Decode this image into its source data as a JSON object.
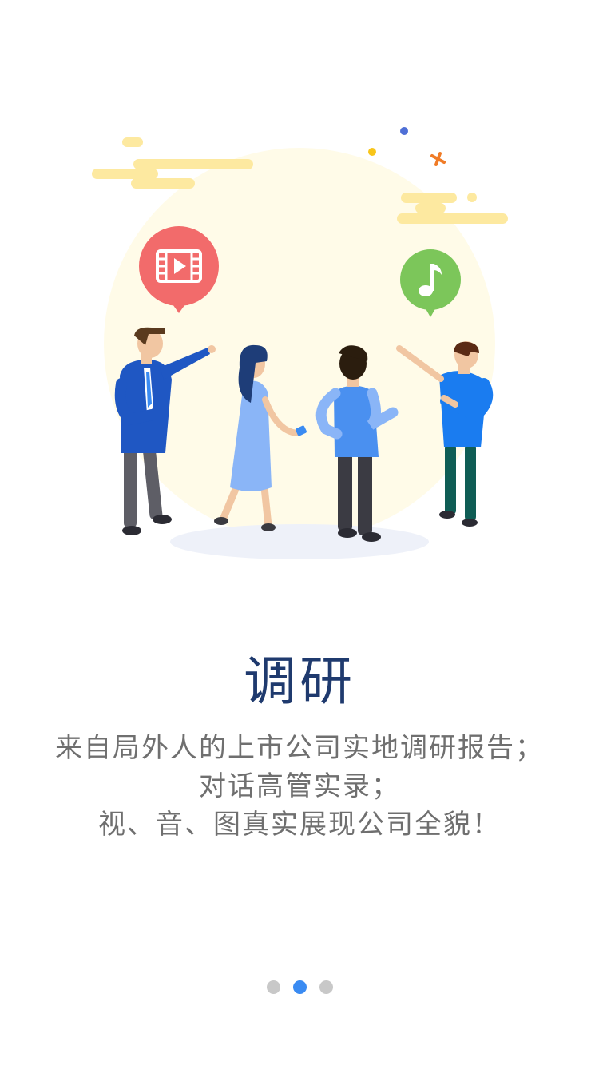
{
  "page": {
    "title": "调研",
    "description_lines": [
      "来自局外人的上市公司实地调研报告；",
      "对话高管实录；",
      "视、音、图真实展现公司全貌！"
    ]
  },
  "illustration": {
    "icons": [
      "video-icon",
      "music-note-icon"
    ],
    "colors": {
      "video_bubble": "#f26b6b",
      "music_bubble": "#7cc65a",
      "background_circle": "#fffbe8",
      "cloud": "#fde9a0",
      "ground_shadow": "#eef1f9"
    }
  },
  "pager": {
    "count": 3,
    "active_index": 1,
    "active_color": "#3a8bf2",
    "inactive_color": "#c8c8c8"
  }
}
